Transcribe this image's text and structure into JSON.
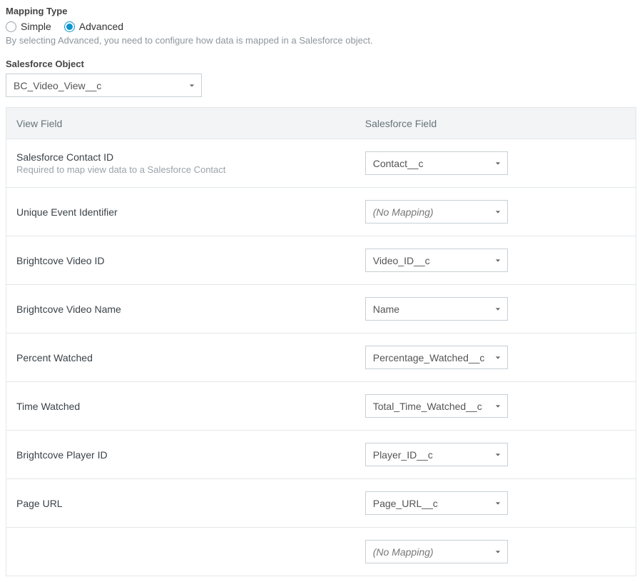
{
  "mapping_type": {
    "title": "Mapping Type",
    "options": {
      "simple": "Simple",
      "advanced": "Advanced"
    },
    "selected": "advanced",
    "help_text": "By selecting Advanced, you need to configure how data is mapped in a Salesforce object."
  },
  "sf_object": {
    "title": "Salesforce Object",
    "value": "BC_Video_View__c"
  },
  "table": {
    "header": {
      "view_field": "View Field",
      "sf_field": "Salesforce Field"
    },
    "rows": [
      {
        "label": "Salesforce Contact ID",
        "sub": "Required to map view data to a Salesforce Contact",
        "value": "Contact__c",
        "italic": false
      },
      {
        "label": "Unique Event Identifier",
        "sub": "",
        "value": "(No Mapping)",
        "italic": true
      },
      {
        "label": "Brightcove Video ID",
        "sub": "",
        "value": "Video_ID__c",
        "italic": false
      },
      {
        "label": "Brightcove Video Name",
        "sub": "",
        "value": "Name",
        "italic": false
      },
      {
        "label": "Percent Watched",
        "sub": "",
        "value": "Percentage_Watched__c",
        "italic": false
      },
      {
        "label": "Time Watched",
        "sub": "",
        "value": "Total_Time_Watched__c",
        "italic": false
      },
      {
        "label": "Brightcove Player ID",
        "sub": "",
        "value": "Player_ID__c",
        "italic": false
      },
      {
        "label": "Page URL",
        "sub": "",
        "value": "Page_URL__c",
        "italic": false
      },
      {
        "label": "",
        "sub": "",
        "value": "(No Mapping)",
        "italic": true,
        "cutoff": true
      }
    ]
  }
}
